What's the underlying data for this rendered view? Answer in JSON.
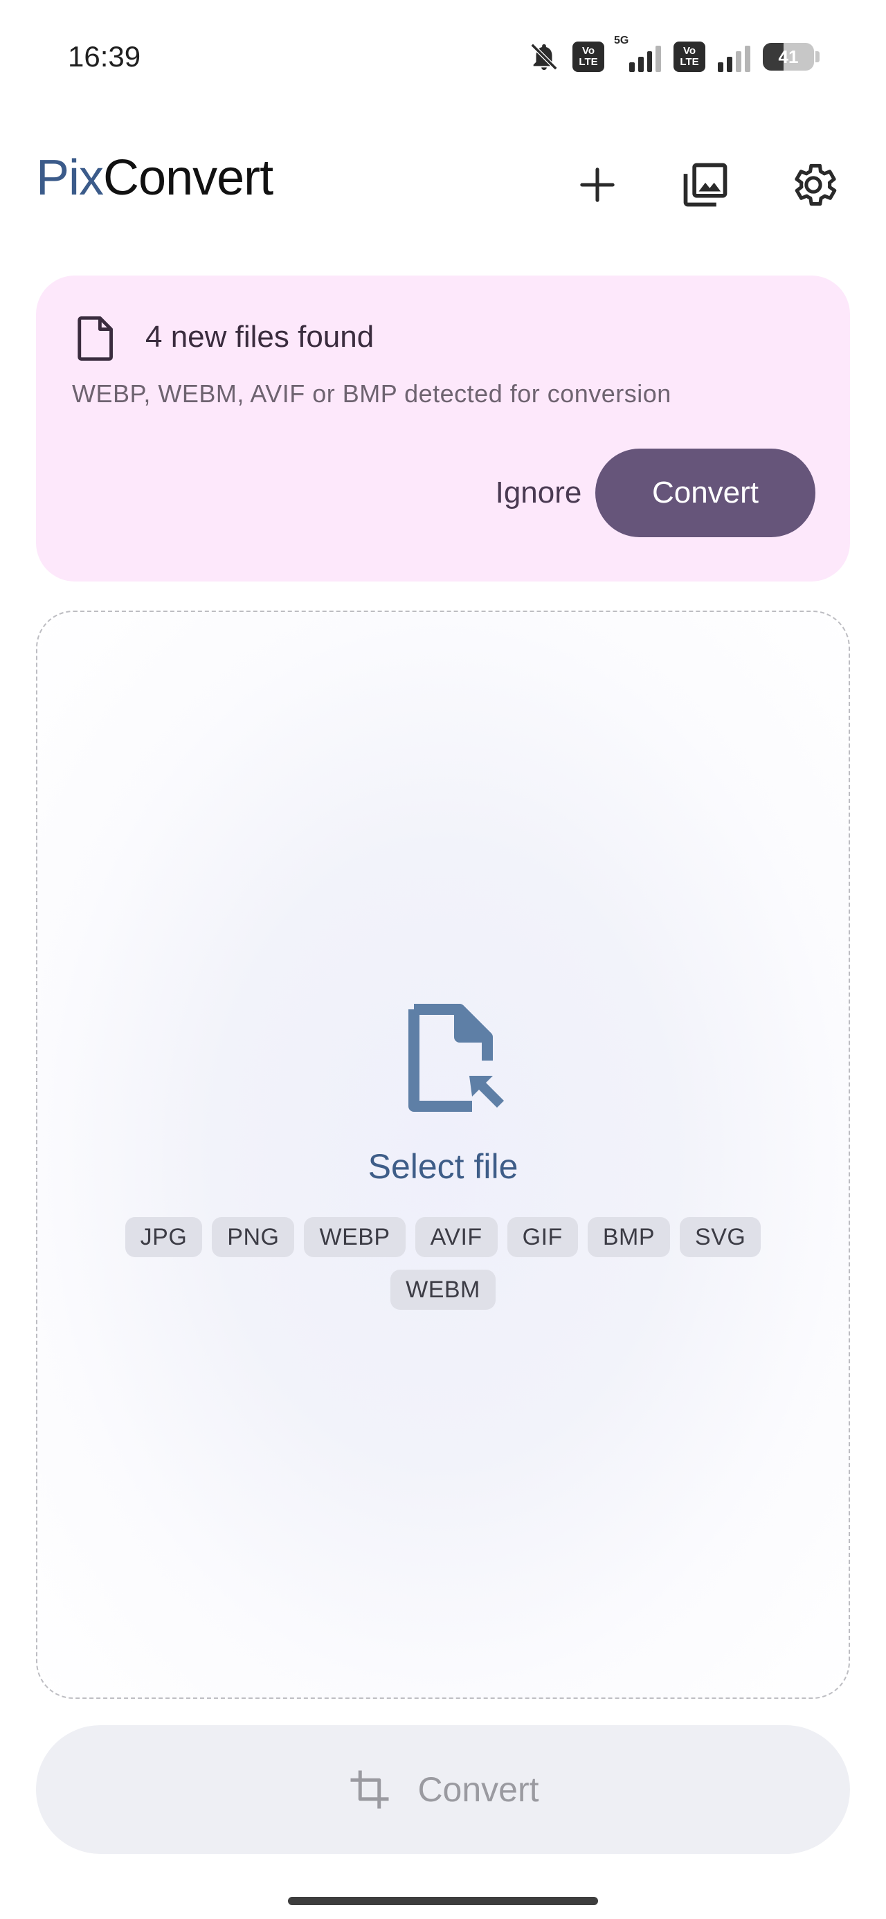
{
  "status_bar": {
    "time": "16:39",
    "icons": [
      "bell-off-icon",
      "volte-icon",
      "signal-5g-icon",
      "volte-icon",
      "signal-icon"
    ],
    "volte_label_top": "Vo",
    "volte_label_bottom": "LTE",
    "network_label": "5G",
    "battery_level": "41"
  },
  "app_bar": {
    "brand_part1": "Pix",
    "brand_part2": "Convert",
    "actions": [
      "add-icon",
      "gallery-icon",
      "settings-icon"
    ]
  },
  "banner": {
    "icon": "file-icon",
    "title": "4 new files found",
    "subtitle": "WEBP, WEBM, AVIF or BMP detected for conversion",
    "ignore_label": "Ignore",
    "convert_label": "Convert"
  },
  "dropzone": {
    "icon": "file-select-icon",
    "label": "Select file",
    "formats": [
      "JPG",
      "PNG",
      "WEBP",
      "AVIF",
      "GIF",
      "BMP",
      "SVG",
      "WEBM"
    ]
  },
  "bottom_action": {
    "icon": "crop-icon",
    "label": "Convert"
  },
  "colors": {
    "brand_accent": "#3b5b8a",
    "banner_bg": "#fde8fb",
    "primary_button": "#66557a",
    "select_accent": "#5e7fa6"
  }
}
